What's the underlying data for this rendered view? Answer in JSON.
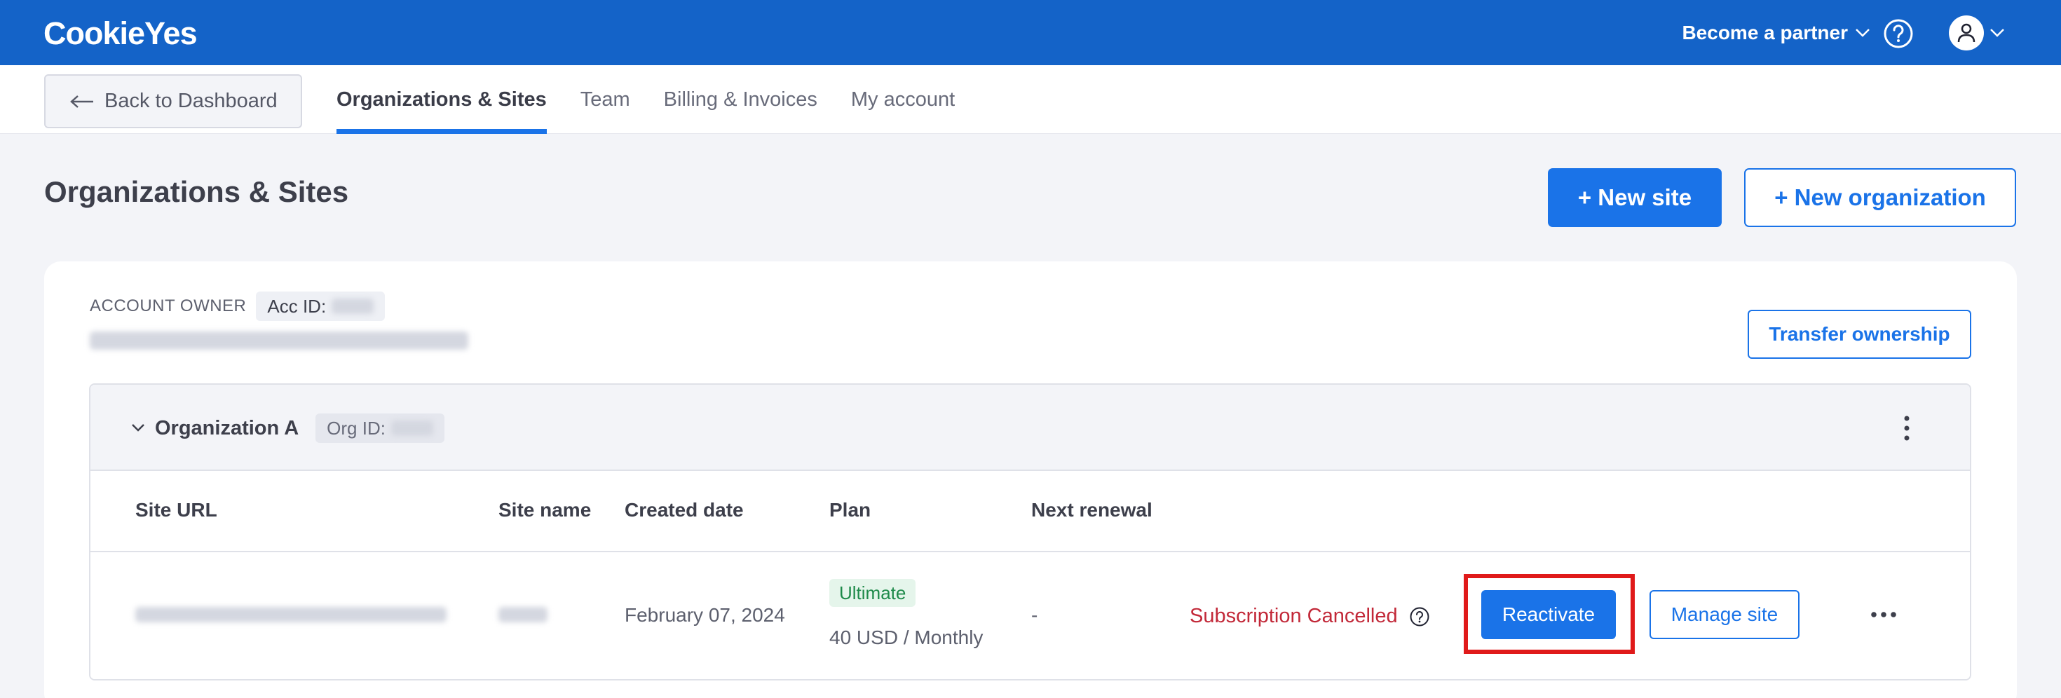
{
  "header": {
    "logo_text": "CookieYes",
    "partner_label": "Become a partner",
    "icons": {
      "help": "question-circle-icon",
      "user": "user-icon",
      "chevron": "chevron-down-icon"
    }
  },
  "subnav": {
    "back_label": "Back to Dashboard",
    "tabs": [
      {
        "label": "Organizations & Sites",
        "active": true
      },
      {
        "label": "Team",
        "active": false
      },
      {
        "label": "Billing & Invoices",
        "active": false
      },
      {
        "label": "My account",
        "active": false
      }
    ]
  },
  "page": {
    "title": "Organizations & Sites",
    "new_site_label": "+ New site",
    "new_org_label": "+ New organization"
  },
  "account": {
    "owner_label": "ACCOUNT OWNER",
    "acc_id_label": "Acc ID:",
    "transfer_label": "Transfer ownership"
  },
  "organization": {
    "name": "Organization A",
    "org_id_label": "Org ID:",
    "columns": [
      "Site URL",
      "Site name",
      "Created date",
      "Plan",
      "Next renewal"
    ],
    "rows": [
      {
        "created_date": "February 07, 2024",
        "plan_badge": "Ultimate",
        "plan_price": "40 USD / Monthly",
        "next_renewal": "-",
        "status": "Subscription Cancelled",
        "reactivate_label": "Reactivate",
        "manage_label": "Manage site"
      }
    ]
  },
  "colors": {
    "topbar": "#1463c8",
    "accent": "#1a73e8",
    "danger": "#c22838",
    "highlight": "#e01a1a",
    "badge_bg": "#e5f5eb",
    "badge_text": "#1e8a4a"
  }
}
